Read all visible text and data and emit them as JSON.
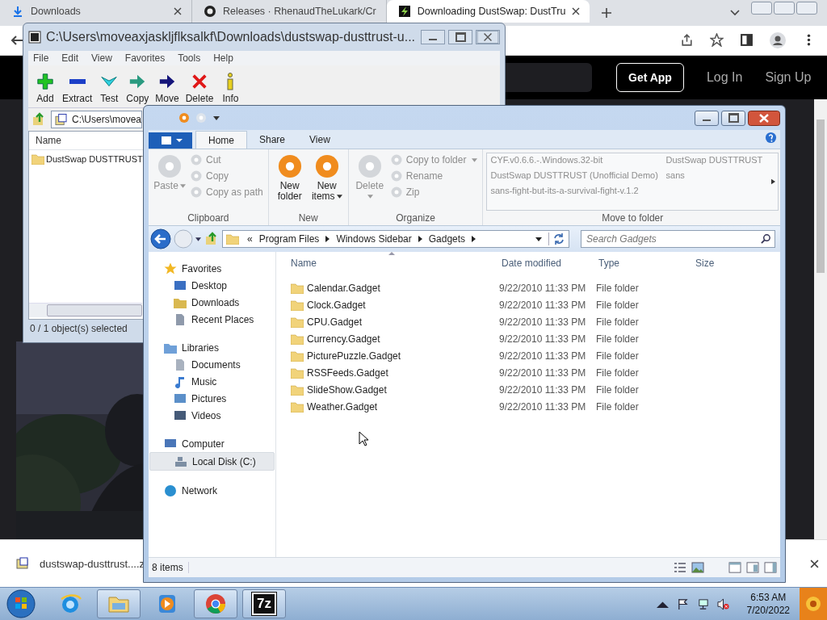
{
  "browser": {
    "tabs": [
      {
        "label": "Downloads",
        "kind": "download",
        "selected": false,
        "closable": true
      },
      {
        "label": "Releases · RhenaudTheLukark/Cr",
        "kind": "github",
        "selected": false,
        "closable": false
      },
      {
        "label": "Downloading DustSwap: DustTru",
        "kind": "site",
        "selected": true,
        "closable": true
      }
    ],
    "header_buttons": [
      {
        "label": "Get App",
        "kind": "outlined"
      },
      {
        "label": "Log In",
        "kind": "plain"
      },
      {
        "label": "Sign Up",
        "kind": "plain"
      }
    ],
    "download": {
      "file": "dustswap-dusttrust....z"
    }
  },
  "archive_window": {
    "title": "C:\\Users\\moveaxjaskljflksalkf\\Downloads\\dustswap-dusttrust-u...",
    "menu": [
      "File",
      "Edit",
      "View",
      "Favorites",
      "Tools",
      "Help"
    ],
    "toolbar": [
      {
        "label": "Add",
        "kind": "add"
      },
      {
        "label": "Extract",
        "kind": "extract"
      },
      {
        "label": "Test",
        "kind": "test"
      },
      {
        "label": "Copy",
        "kind": "copy"
      },
      {
        "label": "Move",
        "kind": "move"
      },
      {
        "label": "Delete",
        "kind": "delete"
      },
      {
        "label": "Info",
        "kind": "info"
      }
    ],
    "path": "C:\\Users\\movea",
    "column": "Name",
    "rows": [
      "DustSwap DUSTTRUST"
    ],
    "status": "0 / 1 object(s) selected"
  },
  "explorer": {
    "tabs": [
      {
        "label": "Home",
        "selected": true
      },
      {
        "label": "Share",
        "selected": false
      },
      {
        "label": "View",
        "selected": false
      }
    ],
    "ribbon": [
      {
        "label": "Clipboard",
        "large": [
          {
            "label": "Paste",
            "disabled": true,
            "dropdown": true
          }
        ],
        "small": [
          {
            "label": "Cut",
            "disabled": true,
            "dropdown": false
          },
          {
            "label": "Copy",
            "disabled": true,
            "dropdown": false
          },
          {
            "label": "Copy as path",
            "disabled": true,
            "dropdown": false
          }
        ]
      },
      {
        "label": "New",
        "large": [
          {
            "label": "New folder",
            "disabled": false,
            "dropdown": false
          },
          {
            "label": "New items",
            "disabled": false,
            "dropdown": true
          }
        ]
      },
      {
        "label": "Organize",
        "large": [
          {
            "label": "Delete",
            "disabled": true,
            "dropdown": true
          }
        ],
        "small": [
          {
            "label": "Copy to folder",
            "disabled": true,
            "dropdown": true
          },
          {
            "label": "Rename",
            "disabled": true,
            "dropdown": false
          },
          {
            "label": "Zip",
            "disabled": true,
            "dropdown": false
          }
        ]
      }
    ],
    "move_to_folder": {
      "label": "Move to folder",
      "items": [
        "CYF.v0.6.6.-.Windows.32-bit",
        "DustSwap DUSTTRUST (Unofficial Demo)",
        "sans-fight-but-its-a-survival-fight-v.1.2",
        "DustSwap DUSTTRUST",
        "sans"
      ]
    },
    "breadcrumb": {
      "overflow": "«",
      "parts": [
        "Program Files",
        "Windows Sidebar",
        "Gadgets"
      ]
    },
    "search": {
      "placeholder": "Search Gadgets"
    },
    "nav": [
      {
        "label": "Favorites",
        "kind": "favorites",
        "selected": false,
        "children": [
          {
            "label": "Desktop",
            "kind": "desktop",
            "selected": false
          },
          {
            "label": "Downloads",
            "kind": "downloads",
            "selected": false
          },
          {
            "label": "Recent Places",
            "kind": "recent",
            "selected": false
          }
        ]
      },
      {
        "label": "Libraries",
        "kind": "libraries",
        "selected": false,
        "children": [
          {
            "label": "Documents",
            "kind": "documents",
            "selected": false
          },
          {
            "label": "Music",
            "kind": "music",
            "selected": false
          },
          {
            "label": "Pictures",
            "kind": "pictures",
            "selected": false
          },
          {
            "label": "Videos",
            "kind": "videos",
            "selected": false
          }
        ]
      },
      {
        "label": "Computer",
        "kind": "computer",
        "selected": false,
        "children": [
          {
            "label": "Local Disk (C:)",
            "kind": "disk",
            "selected": true
          }
        ]
      },
      {
        "label": "Network",
        "kind": "network",
        "selected": false
      }
    ],
    "columns": [
      "Name",
      "Date modified",
      "Type",
      "Size"
    ],
    "files": [
      {
        "name": "Calendar.Gadget",
        "date": "9/22/2010 11:33 PM",
        "type": "File folder"
      },
      {
        "name": "Clock.Gadget",
        "date": "9/22/2010 11:33 PM",
        "type": "File folder"
      },
      {
        "name": "CPU.Gadget",
        "date": "9/22/2010 11:33 PM",
        "type": "File folder"
      },
      {
        "name": "Currency.Gadget",
        "date": "9/22/2010 11:33 PM",
        "type": "File folder"
      },
      {
        "name": "PicturePuzzle.Gadget",
        "date": "9/22/2010 11:33 PM",
        "type": "File folder"
      },
      {
        "name": "RSSFeeds.Gadget",
        "date": "9/22/2010 11:33 PM",
        "type": "File folder"
      },
      {
        "name": "SlideShow.Gadget",
        "date": "9/22/2010 11:33 PM",
        "type": "File folder"
      },
      {
        "name": "Weather.Gadget",
        "date": "9/22/2010 11:33 PM",
        "type": "File folder"
      }
    ],
    "status": "8 items"
  },
  "taskbar": {
    "apps": [
      {
        "kind": "web-browser",
        "running": false
      },
      {
        "kind": "explorer",
        "running": true
      },
      {
        "kind": "media",
        "running": false
      },
      {
        "kind": "chrome",
        "running": true
      },
      {
        "kind": "archiver",
        "running": true,
        "label": "7z"
      }
    ],
    "time": "6:53 AM",
    "date": "7/20/2022"
  }
}
